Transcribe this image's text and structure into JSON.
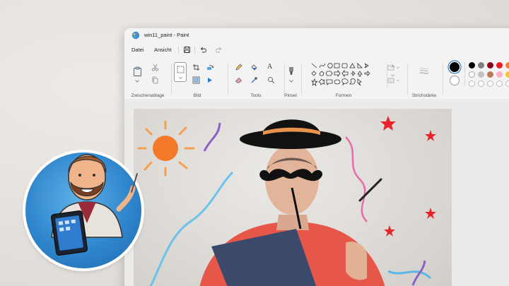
{
  "window": {
    "title": "win11_paint - Paint"
  },
  "menu": {
    "file": "Datei",
    "view": "Ansicht"
  },
  "ribbon": {
    "groups": [
      {
        "label": "Zwischenablage"
      },
      {
        "label": "Bild"
      },
      {
        "label": "Tools"
      },
      {
        "label": "Pinsel"
      },
      {
        "label": "Formen"
      },
      {
        "label": "Strichstärke"
      }
    ],
    "text_tool_glyph": "A"
  },
  "colors": {
    "accent": "#0067c0",
    "current_primary": "#000000",
    "current_secondary": "#ffffff",
    "palette_row1": [
      "#000000",
      "#7f7f7f",
      "#880015",
      "#ed1c24",
      "#ff7f27"
    ],
    "palette_row2": [
      "#ffffff",
      "#c3c3c3",
      "#b97a57",
      "#ffaec9",
      "#ffc90e"
    ]
  },
  "icons": {
    "app": "paint-app-icon",
    "save": "save-icon",
    "undo": "undo-icon",
    "redo": "redo-icon",
    "paste": "paste-icon",
    "cut": "cut-icon",
    "copy": "copy-icon",
    "select": "select-rectangle-icon",
    "crop": "crop-icon",
    "resize": "resize-icon",
    "rotate": "rotate-icon",
    "pencil": "pencil-icon",
    "fill": "fill-bucket-icon",
    "text": "text-icon",
    "eraser": "eraser-icon",
    "picker": "color-picker-icon",
    "magnifier": "magnifier-icon",
    "brush": "brush-icon",
    "outline": "shape-outline-icon",
    "shape_fill": "shape-fill-icon",
    "stroke_size": "stroke-size-icon"
  }
}
